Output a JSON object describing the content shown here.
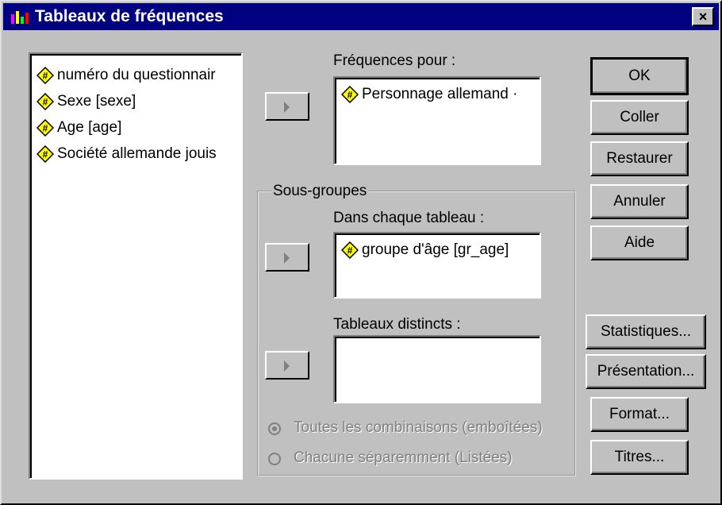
{
  "window": {
    "title": "Tableaux de fréquences",
    "close_glyph": "×"
  },
  "source_list": [
    "numéro du questionnair",
    "Sexe [sexe]",
    "Age [age]",
    "Société allemande jouis"
  ],
  "frequences": {
    "label": "Fréquences pour :",
    "items": [
      "Personnage allemand ·"
    ]
  },
  "sous_groupes": {
    "group_label": "Sous-groupes",
    "dans_label": "Dans chaque tableau :",
    "dans_items": [
      "groupe d'âge [gr_age]"
    ],
    "distincts_label": "Tableaux distincts :",
    "distincts_items": []
  },
  "options": {
    "toutes": "Toutes les combinaisons (emboîtées)",
    "chacune": "Chacune séparemment (Listées)",
    "selected": "toutes",
    "enabled": false
  },
  "buttons": {
    "ok": "OK",
    "coller": "Coller",
    "restaurer": "Restaurer",
    "annuler": "Annuler",
    "aide": "Aide",
    "statistiques": "Statistiques...",
    "presentation": "Présentation...",
    "format": "Format...",
    "titres": "Titres..."
  },
  "colors": {
    "titlebar": "#000080",
    "face": "#c0c0c0",
    "variable_icon": "#ffff00"
  },
  "icons": {
    "variable": "numeric-variable-icon",
    "app": "spss-app-icon"
  }
}
